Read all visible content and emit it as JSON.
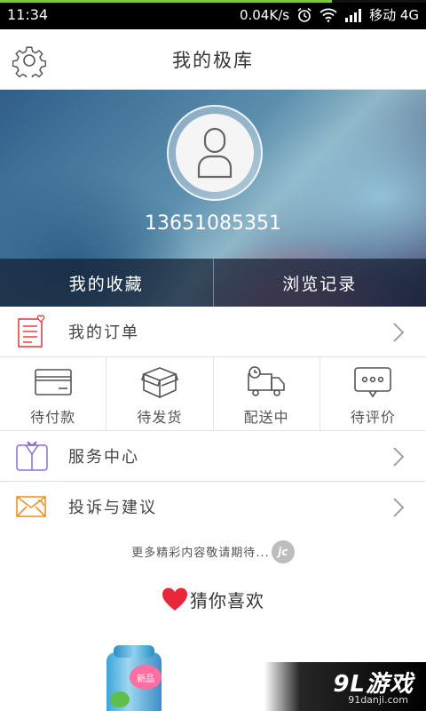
{
  "status_bar": {
    "time": "11:34",
    "speed": "0.04K/s",
    "carrier": "移动 4G"
  },
  "header": {
    "title": "我的极库"
  },
  "profile": {
    "phone": "13651085351",
    "tabs": [
      {
        "label": "我的收藏"
      },
      {
        "label": "浏览记录"
      }
    ]
  },
  "orders": {
    "label": "我的订单",
    "statuses": [
      {
        "label": "待付款",
        "icon": "card-icon"
      },
      {
        "label": "待发货",
        "icon": "box-icon"
      },
      {
        "label": "配送中",
        "icon": "truck-icon"
      },
      {
        "label": "待评价",
        "icon": "comment-icon"
      }
    ]
  },
  "menu": {
    "service": {
      "label": "服务中心",
      "icon": "service-icon"
    },
    "feedback": {
      "label": "投诉与建议",
      "icon": "envelope-icon"
    }
  },
  "more_text": "更多精彩内容敬请期待...",
  "badge_text": "jc",
  "recommend": {
    "title": "猜你喜欢",
    "product_tag": "新品"
  },
  "watermark": {
    "main": "9L游戏",
    "sub": "91danji.com"
  },
  "colors": {
    "accent_red": "#e8403e",
    "heart_red": "#e8283a",
    "purple": "#8a6fcf",
    "orange": "#f0922b"
  }
}
